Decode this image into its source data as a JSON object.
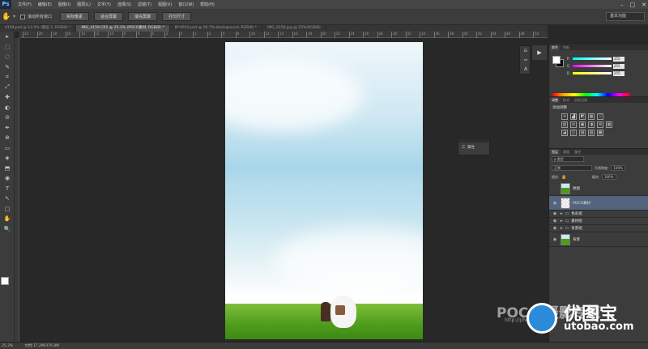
{
  "app": {
    "logo": "Ps"
  },
  "menu": [
    "文件(F)",
    "编辑(E)",
    "图像(I)",
    "图层(L)",
    "文字(Y)",
    "选择(S)",
    "滤镜(T)",
    "视图(V)",
    "窗口(W)",
    "帮助(H)"
  ],
  "window_controls": [
    "–",
    "□",
    "✕"
  ],
  "options_bar": {
    "scroll_all_label": "滚动所有窗口",
    "buttons": [
      "实际像素",
      "适合屏幕",
      "填充屏幕",
      "打印尺寸"
    ],
    "workspace": "基本功能"
  },
  "tabs": [
    {
      "label": "4159.psd @ 12.5% (图层 2, RGB/8) *",
      "active": false
    },
    {
      "label": "IMG_4159.CR2 @ 25.3% (POCO素材, RGB/8) *",
      "active": true
    },
    {
      "label": "BY-0610.psd @ 16.7% (background, RGB/8) *",
      "active": false
    },
    {
      "label": "IMG_4159.jpg @ 25%(RGB/8)",
      "active": false
    }
  ],
  "ruler_ticks": [
    "22",
    "20",
    "18",
    "16",
    "14",
    "12",
    "10",
    "8",
    "6",
    "4",
    "2",
    "0",
    "2",
    "4",
    "6",
    "8",
    "10",
    "12",
    "14",
    "16",
    "18",
    "20",
    "22",
    "24",
    "26",
    "28",
    "30",
    "32",
    "34",
    "36",
    "38",
    "40",
    "42",
    "44",
    "46",
    "48",
    "50"
  ],
  "tools": [
    "▸",
    "⬚",
    "◌",
    "✎",
    "⌗",
    "⤢",
    "✚",
    "◐",
    "⊘",
    "✒",
    "⊕",
    "▭",
    "◈",
    "⬒",
    "◉",
    "T",
    "↖",
    "▢",
    "✋",
    "🔍"
  ],
  "properties_panel": {
    "label": "属性"
  },
  "color_panel": {
    "tabs": [
      "颜色",
      "色板"
    ],
    "channels": [
      {
        "name": "R",
        "value": "255",
        "gradient": "linear-gradient(90deg,#00ffff,#ffffff)"
      },
      {
        "name": "G",
        "value": "255",
        "gradient": "linear-gradient(90deg,#ff00ff,#ffffff)"
      },
      {
        "name": "B",
        "value": "255",
        "gradient": "linear-gradient(90deg,#ffff00,#ffffff)"
      }
    ]
  },
  "adjust_panel": {
    "tabs": [
      "调整",
      "样式",
      "历史记录"
    ],
    "title": "添加调整",
    "row1": [
      "☀",
      "▟",
      "◩",
      "▦",
      "▽"
    ],
    "row2": [
      "▥",
      "⚖",
      "▣",
      "◑",
      "⊛",
      "▦"
    ],
    "row3": [
      "◪",
      "◫",
      "▨",
      "▧",
      "▩"
    ]
  },
  "layers_panel": {
    "tabs": [
      "图层",
      "通道",
      "路径"
    ],
    "filter": "ρ 类型",
    "blend_mode": "正常",
    "opacity_label": "不透明度:",
    "opacity": "100%",
    "lock_label": "锁定:",
    "fill_label": "填充:",
    "fill": "100%",
    "layers": [
      {
        "name": "原图",
        "type": "layer",
        "visible": false,
        "selected": false,
        "thumb": "linear-gradient(180deg,#cfe8f2 40%,#4e9b1c 40%)"
      },
      {
        "name": "POCO素材",
        "type": "layer",
        "visible": true,
        "selected": true,
        "thumb": "repeating-conic-gradient(#ddd 0% 25%, #fff 0% 50%) 0 0/4px 4px"
      },
      {
        "name": "色彩组",
        "type": "group",
        "visible": true,
        "selected": false
      },
      {
        "name": "素材组",
        "type": "group",
        "visible": true,
        "selected": false
      },
      {
        "name": "背景组",
        "type": "group",
        "visible": true,
        "selected": false
      },
      {
        "name": "背景",
        "type": "layer",
        "visible": true,
        "selected": false,
        "thumb": "linear-gradient(180deg,#cfe8f2 40%,#4e9b1c 40%)"
      }
    ]
  },
  "status": {
    "zoom": "25.3%",
    "doc": "文档:17.2M/376.8M"
  },
  "watermark": {
    "poco": "POCO 摄影专题",
    "url": "http://photo.poco.cn/",
    "brand_cn": "优图宝",
    "brand_en": "utobao.com"
  }
}
